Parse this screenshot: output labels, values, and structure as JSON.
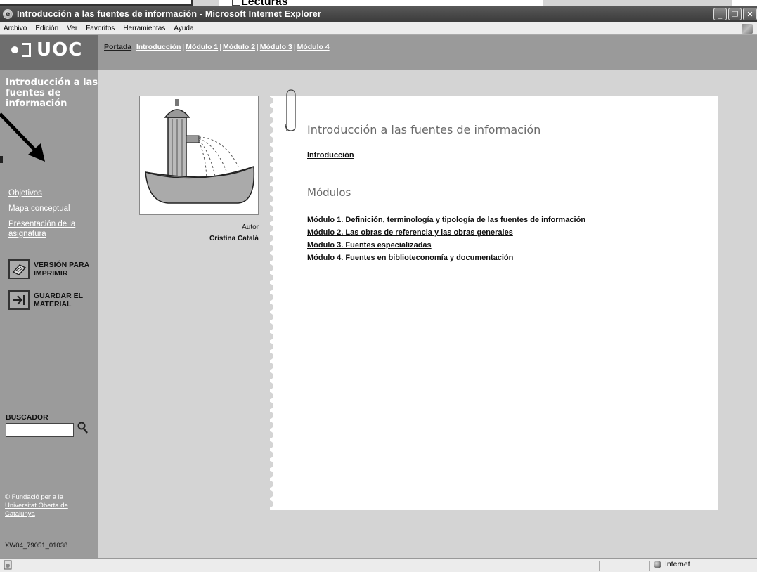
{
  "fragment": {
    "title": "Lecturas"
  },
  "window": {
    "title": "Introducción a las fuentes de información - Microsoft Internet Explorer",
    "min": "_",
    "max": "❐",
    "close": "✕"
  },
  "menubar": [
    "Archivo",
    "Edición",
    "Ver",
    "Favoritos",
    "Herramientas",
    "Ayuda"
  ],
  "logo": "UOC",
  "nav": {
    "items": [
      "Portada",
      "Introducción",
      "Módulo 1",
      "Módulo 2",
      "Módulo 3",
      "Módulo 4"
    ],
    "separator": "|"
  },
  "sidebar": {
    "course_title": "Introducción a las fuentes de información",
    "links": [
      "Objetivos",
      "Mapa conceptual",
      "Presentación de la asignatura"
    ],
    "print_label": "VERSIÓN PARA IMPRIMIR",
    "save_label": "GUARDAR EL MATERIAL",
    "search_label": "BUSCADOR",
    "copyright_symbol": "©",
    "copyright_link": "Fundació per a la Universitat Oberta de Catalunya",
    "code": "XW04_79051_01038"
  },
  "main": {
    "author_label": "Autor",
    "author_name": "Cristina Català",
    "title": "Introducción a las fuentes de información",
    "intro_link": "Introducción",
    "modules_heading": "Módulos",
    "modules": [
      "Módulo 1. Definición, terminología y tipología de las fuentes de información",
      "Módulo 2. Las obras de referencia y las obras generales",
      "Módulo 3. Fuentes especializadas",
      "Módulo 4. Fuentes en biblioteconomía y documentación"
    ]
  },
  "status": {
    "zone": "Internet"
  },
  "colors": {
    "sidebar": "#9b9b9b",
    "header": "#9a9a9a",
    "logo_bg": "#6e6e6e",
    "page": "#ffffff",
    "titlebar": "#4a4a4a"
  }
}
